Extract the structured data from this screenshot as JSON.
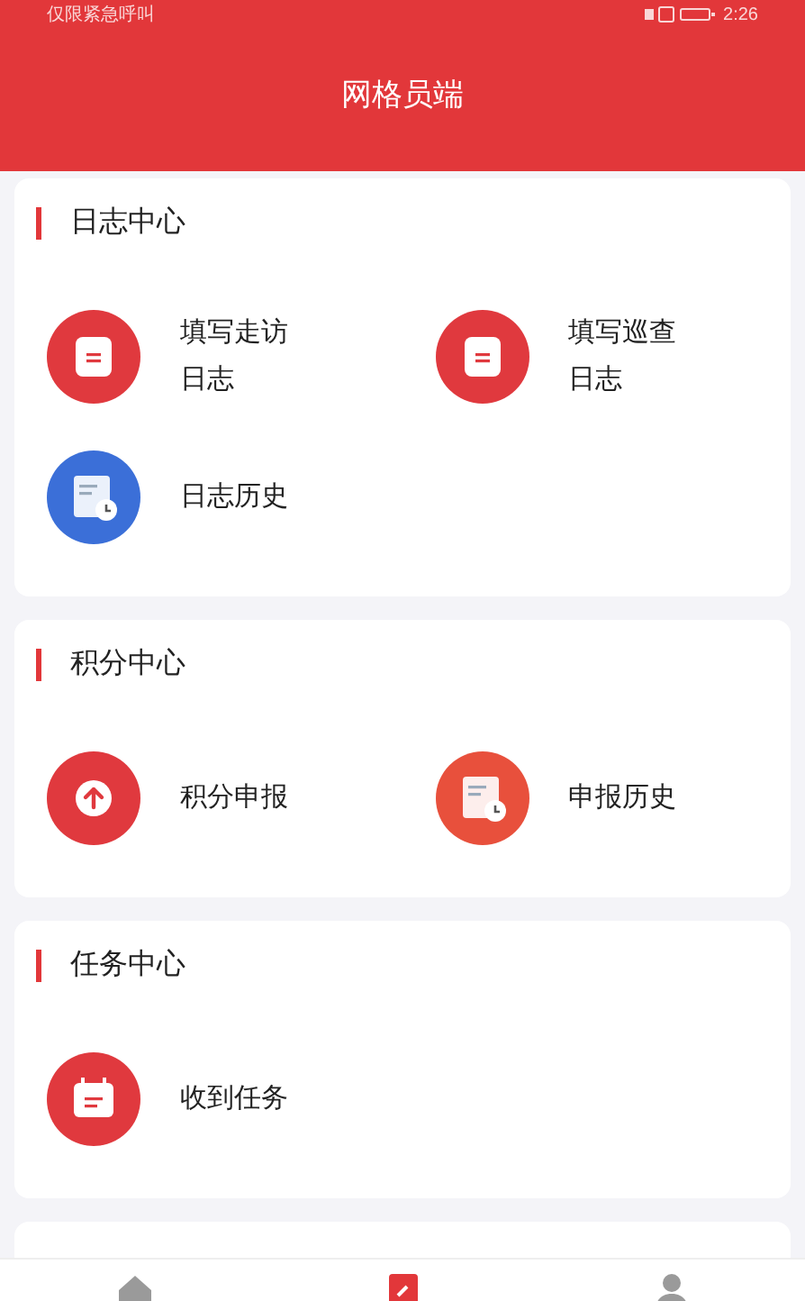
{
  "status_bar": {
    "carrier": "仅限紧急呼叫",
    "time": "2:26"
  },
  "header": {
    "title": "网格员端"
  },
  "sections": [
    {
      "title": "日志中心",
      "items": [
        {
          "label": "填写走访日志",
          "kind": "document",
          "color": "#e0393e"
        },
        {
          "label": "填写巡查日志",
          "kind": "document",
          "color": "#e0393e"
        },
        {
          "label": "日志历史",
          "kind": "history",
          "color": "#3b6fd8"
        }
      ]
    },
    {
      "title": "积分中心",
      "items": [
        {
          "label": "积分申报",
          "kind": "upload",
          "color": "#e0393e"
        },
        {
          "label": "申报历史",
          "kind": "history",
          "color": "#e8503c"
        }
      ]
    },
    {
      "title": "任务中心",
      "items": [
        {
          "label": "收到任务",
          "kind": "calendar",
          "color": "#e0393e"
        }
      ]
    }
  ],
  "bottom_nav": [
    {
      "kind": "home",
      "selected": false
    },
    {
      "kind": "document",
      "selected": true
    },
    {
      "kind": "person",
      "selected": false
    }
  ]
}
